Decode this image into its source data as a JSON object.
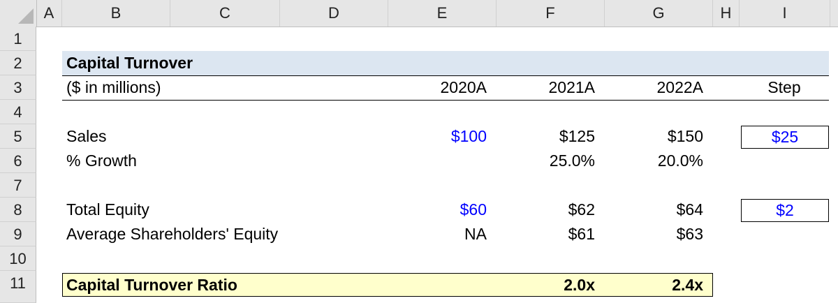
{
  "columns": [
    "A",
    "B",
    "C",
    "D",
    "E",
    "F",
    "G",
    "H",
    "I"
  ],
  "rows": [
    "1",
    "2",
    "3",
    "4",
    "5",
    "6",
    "7",
    "8",
    "9",
    "10",
    "11"
  ],
  "title": "Capital Turnover",
  "units": "($ in millions)",
  "years": [
    "2020A",
    "2021A",
    "2022A"
  ],
  "step_label": "Step",
  "sales": {
    "label": "Sales",
    "values": [
      "$100",
      "$125",
      "$150"
    ],
    "step": "$25"
  },
  "growth": {
    "label": "% Growth",
    "values": [
      "",
      "25.0%",
      "20.0%"
    ]
  },
  "total_equity": {
    "label": "Total Equity",
    "values": [
      "$60",
      "$62",
      "$64"
    ],
    "step": "$2"
  },
  "avg_equity": {
    "label": "Average Shareholders' Equity",
    "values": [
      "NA",
      "$61",
      "$63"
    ]
  },
  "ratio": {
    "label": "Capital Turnover Ratio",
    "values": [
      "",
      "2.0x",
      "2.4x"
    ]
  },
  "colors": {
    "input_blue": "#0000ff",
    "title_band": "#dce6f1",
    "ratio_band": "#ffffcc",
    "header_gray": "#e6e6e6"
  }
}
